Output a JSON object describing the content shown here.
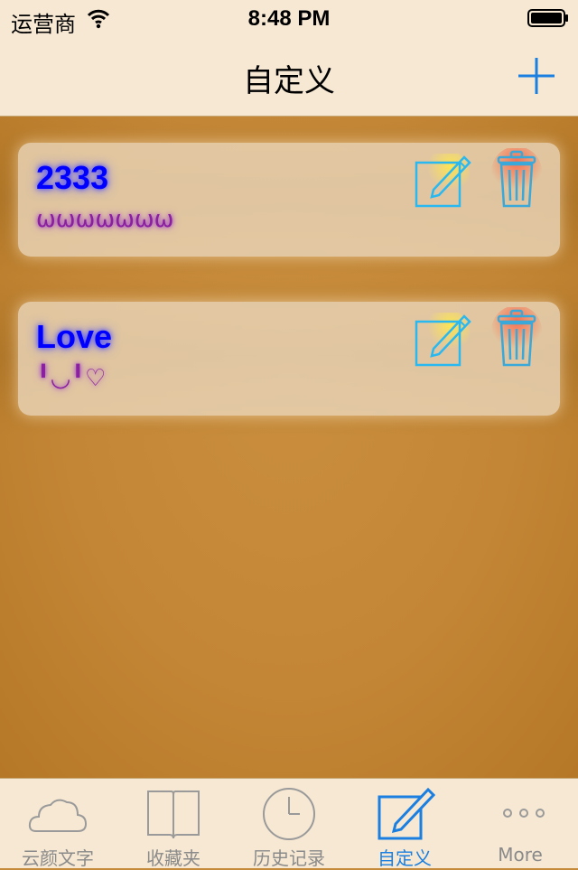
{
  "status_bar": {
    "carrier": "运营商",
    "time": "8:48 PM"
  },
  "nav": {
    "title": "自定义",
    "add_icon": "plus-icon"
  },
  "items": [
    {
      "title": "2333",
      "subtitle": "ωωωωωωω",
      "edit_icon": "edit-icon",
      "delete_icon": "trash-icon"
    },
    {
      "title": "Love",
      "subtitle": "╹◡╹♡",
      "edit_icon": "edit-icon",
      "delete_icon": "trash-icon"
    }
  ],
  "tabs": [
    {
      "label": "云颜文字",
      "icon": "cloud-icon",
      "active": false
    },
    {
      "label": "收藏夹",
      "icon": "book-icon",
      "active": false
    },
    {
      "label": "历史记录",
      "icon": "clock-icon",
      "active": false
    },
    {
      "label": "自定义",
      "icon": "edit-icon",
      "active": true
    },
    {
      "label": "More",
      "icon": "more-icon",
      "active": false
    }
  ],
  "colors": {
    "accent": "#1a7fe0",
    "background": "#c58a3a",
    "bar": "#f6e8d3",
    "title_text": "#0000ff",
    "subtitle_text": "#8a1fa0"
  }
}
